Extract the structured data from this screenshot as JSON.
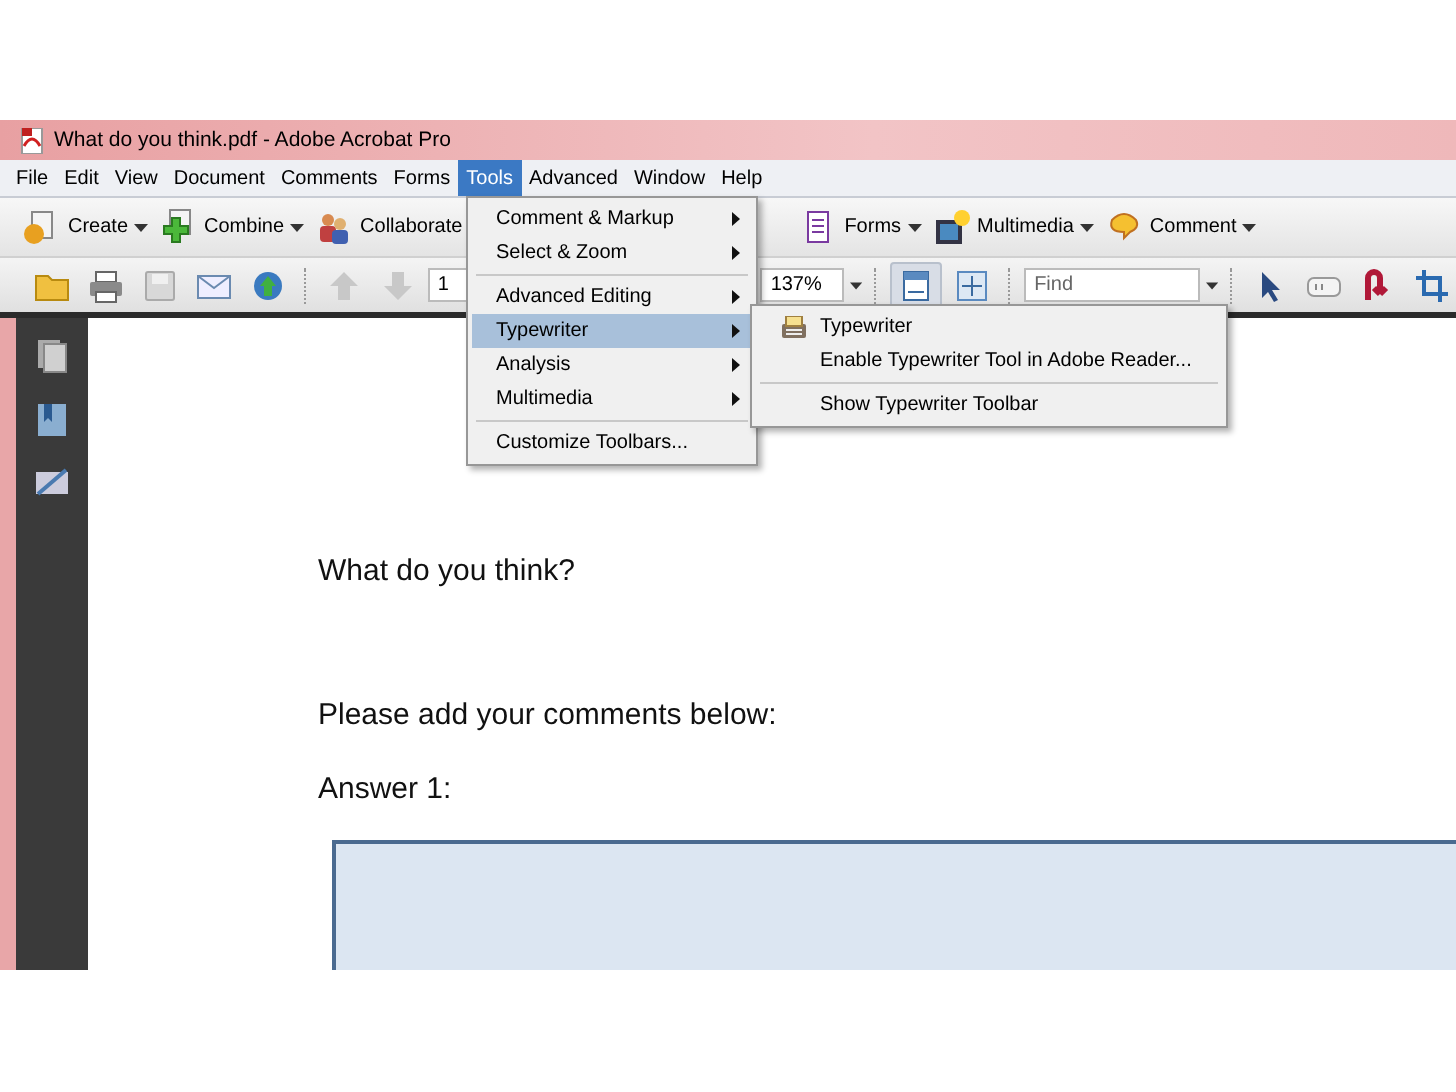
{
  "window": {
    "title": "What do you think.pdf - Adobe Acrobat Pro"
  },
  "menu_bar": [
    {
      "label": "File",
      "selected": false
    },
    {
      "label": "Edit",
      "selected": false
    },
    {
      "label": "View",
      "selected": false
    },
    {
      "label": "Document",
      "selected": false
    },
    {
      "label": "Comments",
      "selected": false
    },
    {
      "label": "Forms",
      "selected": false
    },
    {
      "label": "Tools",
      "selected": true
    },
    {
      "label": "Advanced",
      "selected": false
    },
    {
      "label": "Window",
      "selected": false
    },
    {
      "label": "Help",
      "selected": false
    }
  ],
  "task_toolbar": [
    {
      "label": "Create",
      "kind": "create",
      "dropdown": true
    },
    {
      "label": "Combine",
      "kind": "combine",
      "dropdown": true
    },
    {
      "label": "Collaborate",
      "kind": "collaborate",
      "dropdown": false
    },
    {
      "label": "Forms",
      "kind": "forms",
      "dropdown": true
    },
    {
      "label": "Multimedia",
      "kind": "multimedia",
      "dropdown": true
    },
    {
      "label": "Comment",
      "kind": "comment",
      "dropdown": true
    }
  ],
  "nav_toolbar": {
    "page": "1",
    "zoom": "137%",
    "find_placeholder": "Find"
  },
  "tools_menu": {
    "groups": [
      [
        {
          "label": "Comment & Markup",
          "submenu": true,
          "selected": false
        },
        {
          "label": "Select & Zoom",
          "submenu": true,
          "selected": false
        }
      ],
      [
        {
          "label": "Advanced Editing",
          "submenu": true,
          "selected": false
        },
        {
          "label": "Typewriter",
          "submenu": true,
          "selected": true
        },
        {
          "label": "Analysis",
          "submenu": true,
          "selected": false
        },
        {
          "label": "Multimedia",
          "submenu": true,
          "selected": false
        }
      ],
      [
        {
          "label": "Customize Toolbars...",
          "submenu": false,
          "selected": false
        }
      ]
    ]
  },
  "typewriter_submenu": {
    "groups": [
      [
        {
          "label": "Typewriter",
          "kind": "tool"
        },
        {
          "label": "Enable Typewriter Tool in Adobe Reader...",
          "kind": "command"
        }
      ],
      [
        {
          "label": "Show Typewriter Toolbar",
          "kind": "command"
        }
      ]
    ]
  },
  "document": {
    "paragraphs": [
      "What do you think?",
      "Please add your comments below:",
      "Answer 1:"
    ]
  }
}
